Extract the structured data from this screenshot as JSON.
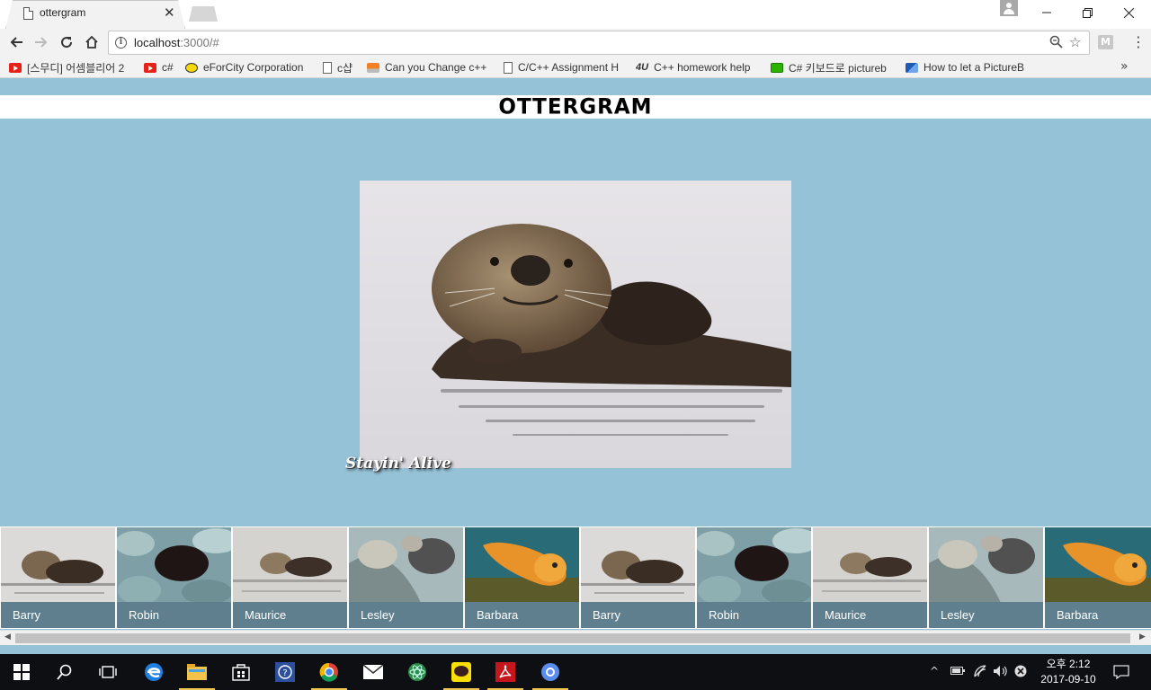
{
  "browser": {
    "tab_title": "ottergram",
    "url_host": "localhost",
    "url_rest": ":3000/#",
    "ext_label": "M",
    "bookmarks": [
      {
        "label": "[스무디] 어셈블리어 2",
        "icon": "youtube-icon"
      },
      {
        "label": "c#",
        "icon": "youtube-icon"
      },
      {
        "label": "eForCity Corporation",
        "icon": "eforcity-icon"
      },
      {
        "label": "c샵",
        "icon": "page-icon"
      },
      {
        "label": "Can you Change c++",
        "icon": "stackoverflow-icon"
      },
      {
        "label": "C/C++ Assignment H",
        "icon": "page-icon"
      },
      {
        "label": "C++ homework help",
        "icon": "4u-icon"
      },
      {
        "label": "C# 키보드로 pictureb",
        "icon": "green-site-icon"
      },
      {
        "label": "How to let a PictureB",
        "icon": "blue-site-icon"
      }
    ],
    "bookmark_4u_text": "4U",
    "bookmark_more": "»"
  },
  "page": {
    "logo": "OTTERGRAM",
    "detail_title": "Stayin' Alive",
    "thumbnails": [
      {
        "label": "Barry",
        "image": "otter-floating"
      },
      {
        "label": "Robin",
        "image": "otter-on-rocks"
      },
      {
        "label": "Maurice",
        "image": "otter-resting"
      },
      {
        "label": "Lesley",
        "image": "otter-pair"
      },
      {
        "label": "Barbara",
        "image": "otter-orange-sunset"
      },
      {
        "label": "Barry",
        "image": "otter-floating"
      },
      {
        "label": "Robin",
        "image": "otter-on-rocks"
      },
      {
        "label": "Maurice",
        "image": "otter-resting"
      },
      {
        "label": "Lesley",
        "image": "otter-pair"
      },
      {
        "label": "Barbara",
        "image": "otter-orange-sunset"
      }
    ]
  },
  "taskbar": {
    "time": "오후 2:12",
    "date": "2017-09-10"
  },
  "colors": {
    "page_bg": "#96c2d8",
    "thumb_label_bg": "#5f7f8e",
    "taskbar_bg": "#0e0f12"
  }
}
